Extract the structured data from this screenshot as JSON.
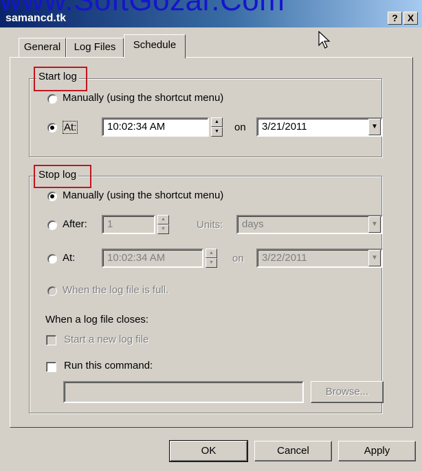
{
  "watermark": "www.SoftGozar.Com",
  "window": {
    "title": "samancd.tk",
    "help_label": "?",
    "close_label": "X"
  },
  "tabs": [
    {
      "label": "General",
      "active": false
    },
    {
      "label": "Log Files",
      "active": false
    },
    {
      "label": "Schedule",
      "active": true
    }
  ],
  "start_log": {
    "legend": "Start log",
    "manual_label": "Manually (using the shortcut menu)",
    "at_label": "At:",
    "time": "10:02:34 AM",
    "on_label": "on",
    "date": "3/21/2011",
    "selected": "at"
  },
  "stop_log": {
    "legend": "Stop log",
    "manual_label": "Manually (using the shortcut menu)",
    "after_label": "After:",
    "after_value": "1",
    "units_label": "Units:",
    "units_value": "days",
    "at_label": "At:",
    "time": "10:02:34 AM",
    "on_label": "on",
    "date": "3/22/2011",
    "when_full_label": "When the log file is full.",
    "closes_heading": "When a log file closes:",
    "start_new_label": "Start a new log file",
    "run_command_label": "Run this command:",
    "command_value": "",
    "browse_label": "Browse...",
    "selected": "manually"
  },
  "buttons": {
    "ok": "OK",
    "cancel": "Cancel",
    "apply": "Apply"
  },
  "colors": {
    "face": "#d4d0c8",
    "title_blue": "#0a246a",
    "highlight_red": "#c0161f",
    "watermark": "#1515cc"
  }
}
